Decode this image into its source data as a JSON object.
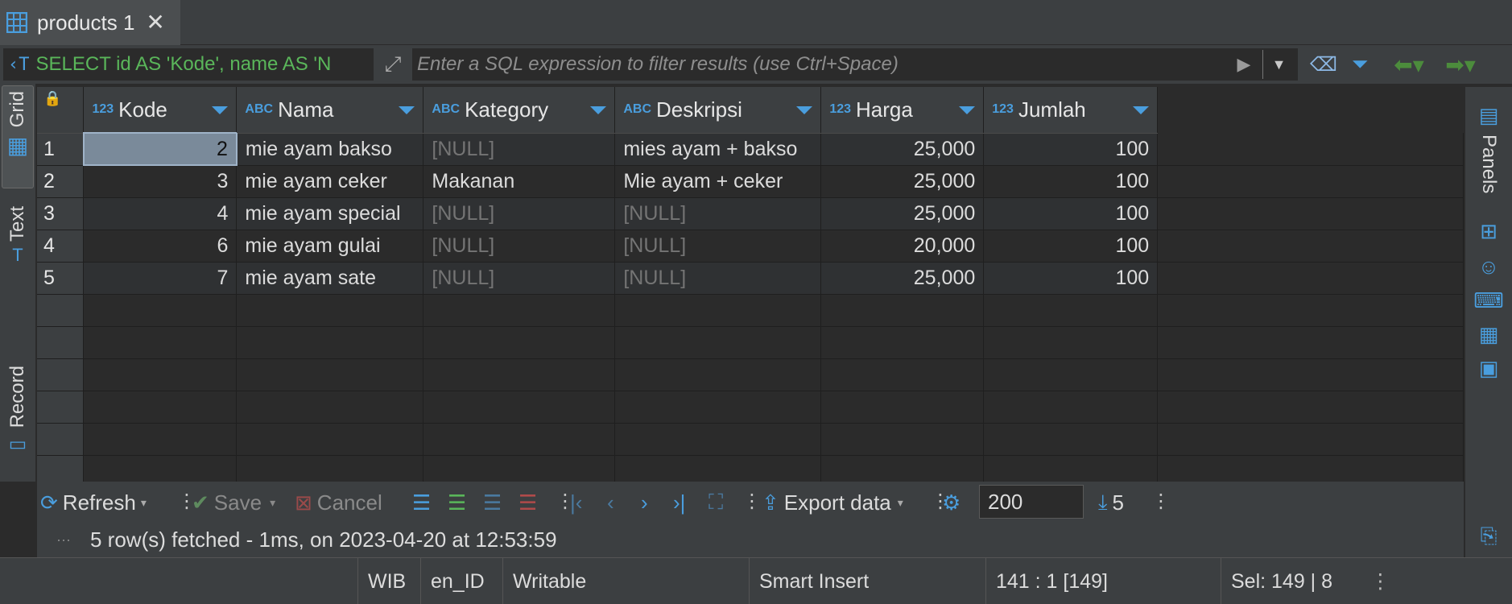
{
  "tab": {
    "title": "products 1",
    "icon": "table-grid-icon"
  },
  "filter": {
    "query_text": "SELECT id AS 'Kode', name AS 'N",
    "placeholder": "Enter a SQL expression to filter results (use Ctrl+Space)"
  },
  "left_tabs": {
    "grid": "Grid",
    "text": "Text",
    "record": "Record"
  },
  "right_panel": {
    "panels_label": "Panels"
  },
  "columns": [
    {
      "type": "123",
      "name": "Kode"
    },
    {
      "type": "ABC",
      "name": "Nama"
    },
    {
      "type": "ABC",
      "name": "Kategory"
    },
    {
      "type": "ABC",
      "name": "Deskripsi"
    },
    {
      "type": "123",
      "name": "Harga"
    },
    {
      "type": "123",
      "name": "Jumlah"
    }
  ],
  "rows": [
    {
      "num": "1",
      "kode": "2",
      "nama": "mie ayam bakso",
      "kategory": "[NULL]",
      "deskripsi": "mies ayam + bakso",
      "harga": "25,000",
      "jumlah": "100"
    },
    {
      "num": "2",
      "kode": "3",
      "nama": "mie ayam ceker",
      "kategory": "Makanan",
      "deskripsi": "Mie ayam + ceker",
      "harga": "25,000",
      "jumlah": "100"
    },
    {
      "num": "3",
      "kode": "4",
      "nama": "mie ayam special",
      "kategory": "[NULL]",
      "deskripsi": "[NULL]",
      "harga": "25,000",
      "jumlah": "100"
    },
    {
      "num": "4",
      "kode": "6",
      "nama": "mie ayam gulai",
      "kategory": "[NULL]",
      "deskripsi": "[NULL]",
      "harga": "20,000",
      "jumlah": "100"
    },
    {
      "num": "5",
      "kode": "7",
      "nama": "mie ayam sate",
      "kategory": "[NULL]",
      "deskripsi": "[NULL]",
      "harga": "25,000",
      "jumlah": "100"
    }
  ],
  "toolbar": {
    "refresh": "Refresh",
    "save": "Save",
    "cancel": "Cancel",
    "export": "Export data",
    "fetch_size": "200",
    "row_count": "5"
  },
  "status_message": "5 row(s) fetched - 1ms, on 2023-04-20 at 12:53:59",
  "statusbar": {
    "timezone": "WIB",
    "locale": "en_ID",
    "mode": "Writable",
    "insert_mode": "Smart Insert",
    "position": "141 : 1 [149]",
    "selection": "Sel: 149 | 8"
  },
  "colors": {
    "accent": "#4a9ede",
    "sql_green": "#5ab65a",
    "nav_green": "#4c8c3c",
    "lock": "#e0b030"
  }
}
